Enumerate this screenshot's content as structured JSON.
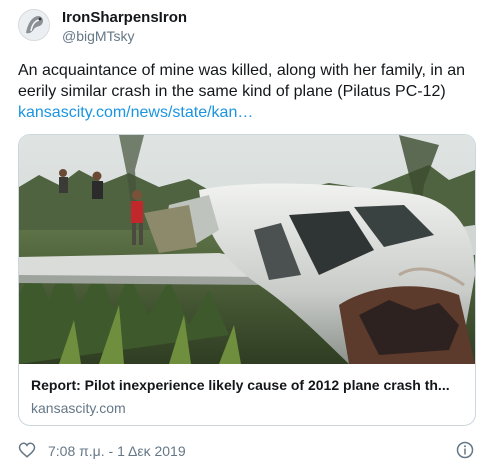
{
  "author": {
    "display_name": "IronSharpensIron",
    "handle": "@bigMTsky"
  },
  "tweet": {
    "text": "An acquaintance of mine was killed, along with her family, in an eerily similar crash in the same kind of plane (Pilatus PC-12)",
    "link_text": "kansascity.com/news/state/kan…"
  },
  "card": {
    "title": "Report: Pilot inexperience likely cause of 2012 plane crash th...",
    "domain": "kansascity.com"
  },
  "footer": {
    "timestamp": "7:08 π.μ. - 1 Δεκ 2019"
  },
  "icons": {
    "like": "heart-icon",
    "info": "info-icon",
    "avatar": "avatar-icon"
  },
  "colors": {
    "link": "#1b95e0",
    "secondary_text": "#657786",
    "border": "#ccd6dd"
  }
}
